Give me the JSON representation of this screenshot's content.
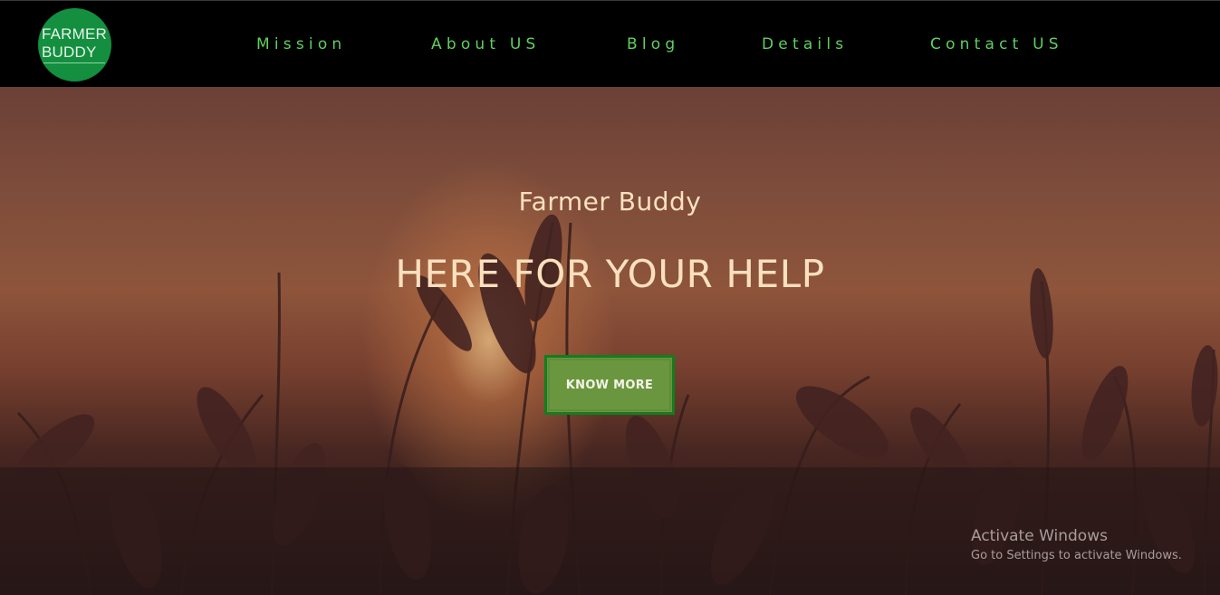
{
  "logo": {
    "line1": "FARMER",
    "line2": "BUDDY",
    "color": "#138f3f"
  },
  "nav": {
    "items": [
      {
        "label": "Mission"
      },
      {
        "label": "About US"
      },
      {
        "label": "Blog"
      },
      {
        "label": "Details"
      },
      {
        "label": "Contact US"
      }
    ],
    "link_color": "#5ed05e"
  },
  "hero": {
    "subtitle": "Farmer Buddy",
    "headline": "HERE FOR YOUR HELP",
    "cta_label": "KNOW MORE",
    "text_color": "#fce0be",
    "cta_color": "#6a963f"
  },
  "watermark": {
    "title": "Activate Windows",
    "subtitle": "Go to Settings to activate Windows."
  }
}
